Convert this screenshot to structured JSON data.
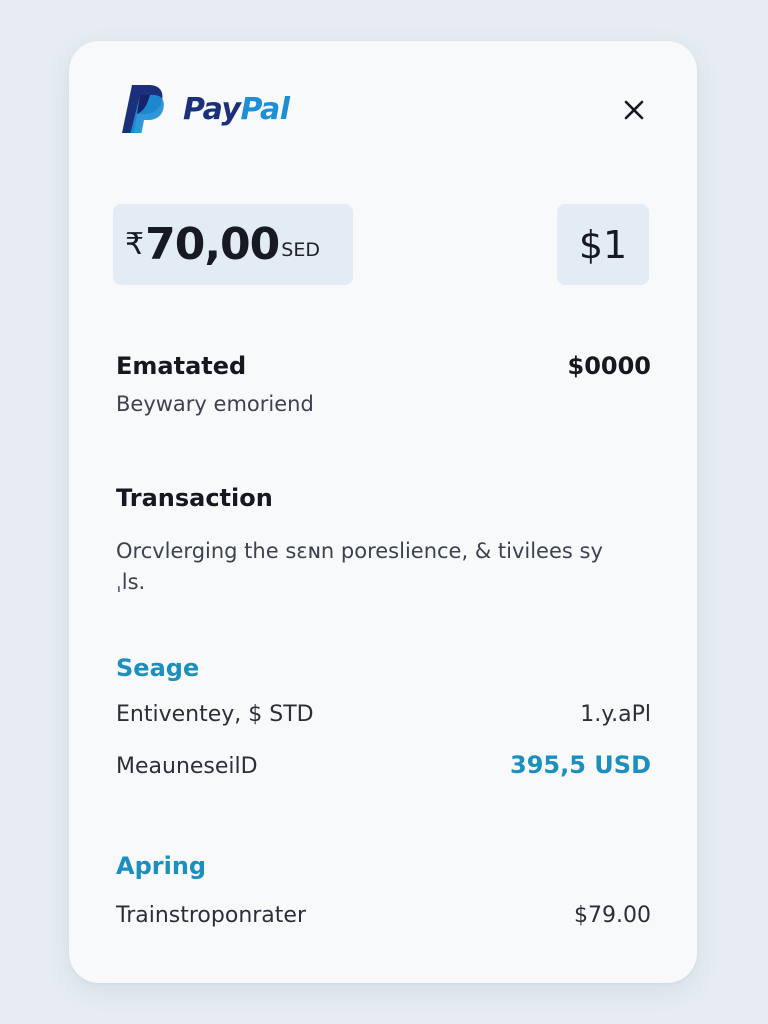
{
  "brand": {
    "name_part1": "Pay",
    "name_part2": "Pal",
    "color_dark": "#1c2f7a",
    "color_light": "#1d8fd6"
  },
  "header": {
    "close_icon": "close-icon",
    "close_glyph": "×"
  },
  "amount": {
    "symbol": "₹",
    "value": "70,00",
    "suffix": "SED"
  },
  "secondary_amount": "$1",
  "estimated": {
    "title": "Ematated",
    "value": "$0000",
    "subtitle": "Beywary emoriend"
  },
  "transaction": {
    "title": "Transaction",
    "description": "Orcvlerging the sɛɴn poreslience, & tivilees syˌls."
  },
  "sections": [
    {
      "title": "Seage",
      "items": [
        {
          "label": "Entiventey, $ STD",
          "value": "1.y.aPl"
        },
        {
          "label": "MeauneseilD",
          "value": "395,5 USD"
        }
      ]
    },
    {
      "title": "Apring",
      "items": [
        {
          "label": "Trainstroponrater",
          "value": "$79.00"
        }
      ]
    }
  ],
  "colors": {
    "accent": "#1c8fbd",
    "background": "#e6ecf2",
    "card": "#f7f9fb",
    "chip": "#e3ecf4"
  }
}
